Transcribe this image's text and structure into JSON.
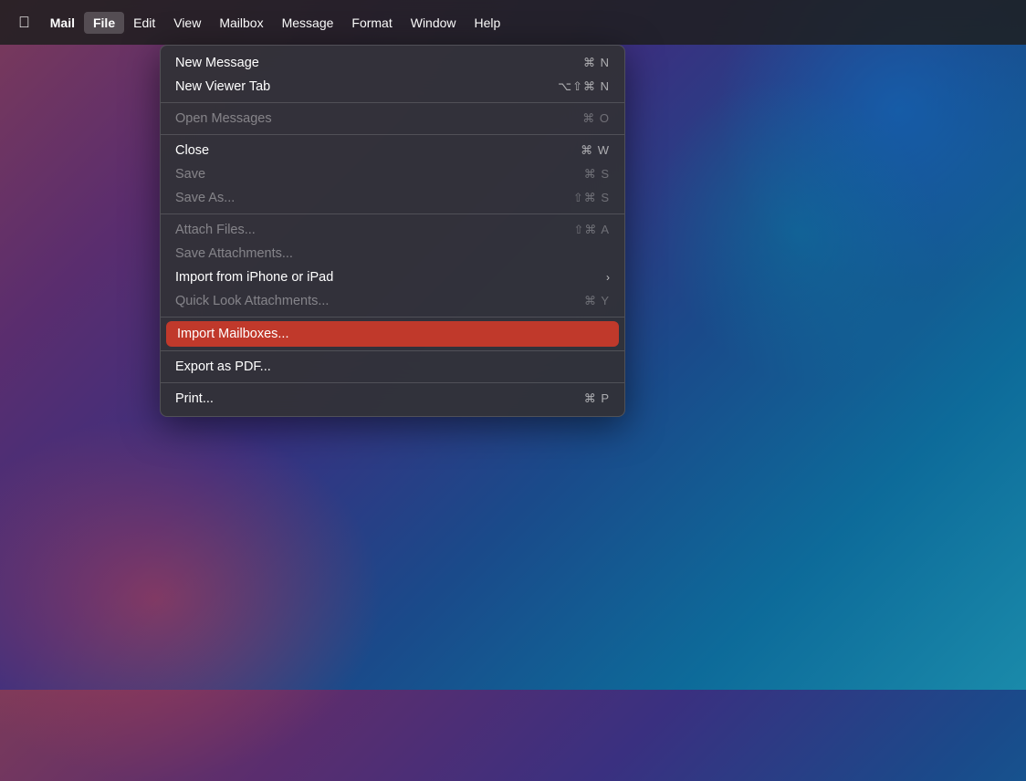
{
  "background": {
    "colors": [
      "#7b3a5a",
      "#5a2d6e",
      "#3a3080",
      "#1a4a8a",
      "#0d6b9a",
      "#1a8aaa"
    ]
  },
  "menubar": {
    "apple_label": "",
    "items": [
      {
        "id": "mail",
        "label": "Mail",
        "bold": true,
        "active": false
      },
      {
        "id": "file",
        "label": "File",
        "bold": true,
        "active": true
      },
      {
        "id": "edit",
        "label": "Edit",
        "bold": false,
        "active": false
      },
      {
        "id": "view",
        "label": "View",
        "bold": false,
        "active": false
      },
      {
        "id": "mailbox",
        "label": "Mailbox",
        "bold": false,
        "active": false
      },
      {
        "id": "message",
        "label": "Message",
        "bold": false,
        "active": false
      },
      {
        "id": "format",
        "label": "Format",
        "bold": false,
        "active": false
      },
      {
        "id": "window",
        "label": "Window",
        "bold": false,
        "active": false
      },
      {
        "id": "help",
        "label": "Help",
        "bold": false,
        "active": false
      }
    ]
  },
  "dropdown": {
    "items": [
      {
        "id": "new-message",
        "label": "New Message",
        "shortcut": "⌘ N",
        "disabled": false,
        "highlighted": false,
        "separator_after": false,
        "has_arrow": false
      },
      {
        "id": "new-viewer-tab",
        "label": "New Viewer Tab",
        "shortcut": "⌥⇧⌘ N",
        "disabled": false,
        "highlighted": false,
        "separator_after": true,
        "has_arrow": false
      },
      {
        "id": "open-messages",
        "label": "Open Messages",
        "shortcut": "⌘ O",
        "disabled": true,
        "highlighted": false,
        "separator_after": false,
        "has_arrow": false
      },
      {
        "id": "close",
        "label": "Close",
        "shortcut": "⌘ W",
        "disabled": false,
        "highlighted": false,
        "separator_after": false,
        "has_arrow": false
      },
      {
        "id": "save",
        "label": "Save",
        "shortcut": "⌘ S",
        "disabled": true,
        "highlighted": false,
        "separator_after": false,
        "has_arrow": false
      },
      {
        "id": "save-as",
        "label": "Save As...",
        "shortcut": "⇧⌘ S",
        "disabled": true,
        "highlighted": false,
        "separator_after": true,
        "has_arrow": false
      },
      {
        "id": "attach-files",
        "label": "Attach Files...",
        "shortcut": "⇧⌘ A",
        "disabled": true,
        "highlighted": false,
        "separator_after": false,
        "has_arrow": false
      },
      {
        "id": "save-attachments",
        "label": "Save Attachments...",
        "shortcut": "",
        "disabled": true,
        "highlighted": false,
        "separator_after": false,
        "has_arrow": false
      },
      {
        "id": "import-iphone-ipad",
        "label": "Import from iPhone or iPad",
        "shortcut": "",
        "disabled": false,
        "highlighted": false,
        "separator_after": false,
        "has_arrow": true
      },
      {
        "id": "quick-look-attachments",
        "label": "Quick Look Attachments...",
        "shortcut": "⌘ Y",
        "disabled": true,
        "highlighted": false,
        "separator_after": true,
        "has_arrow": false
      },
      {
        "id": "import-mailboxes",
        "label": "Import Mailboxes...",
        "shortcut": "",
        "disabled": false,
        "highlighted": true,
        "separator_after": true,
        "has_arrow": false
      },
      {
        "id": "export-pdf",
        "label": "Export as PDF...",
        "shortcut": "",
        "disabled": false,
        "highlighted": false,
        "separator_after": true,
        "has_arrow": false
      },
      {
        "id": "print",
        "label": "Print...",
        "shortcut": "⌘ P",
        "disabled": false,
        "highlighted": false,
        "separator_after": false,
        "has_arrow": false
      }
    ]
  }
}
